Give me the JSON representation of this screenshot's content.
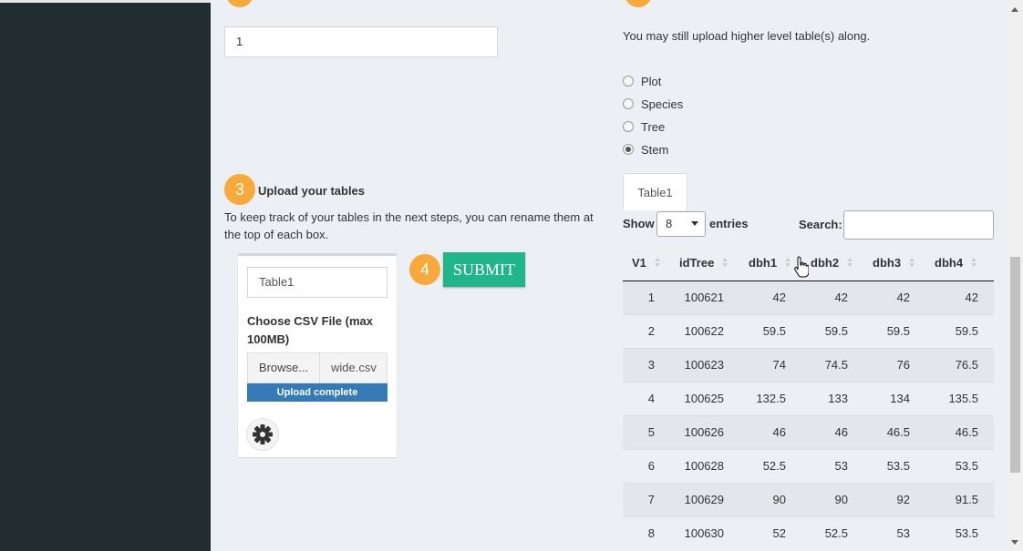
{
  "row_input": {
    "value": "1"
  },
  "step3": {
    "number": "3",
    "title": "Upload your tables",
    "description": "To keep track of your tables in the next steps, you can rename them at the top of each box."
  },
  "upload_box": {
    "table_name": "Table1",
    "csv_label": "Choose CSV File (max 100MB)",
    "browse_label": "Browse...",
    "filename": "wide.csv",
    "progress_label": "Upload complete",
    "progress_fraction": 1.0
  },
  "step4": {
    "number": "4",
    "submit_label": "SUBMIT"
  },
  "level_note": "You may still upload higher level table(s) along.",
  "levels": [
    {
      "label": "Plot",
      "checked": false
    },
    {
      "label": "Species",
      "checked": false
    },
    {
      "label": "Tree",
      "checked": false
    },
    {
      "label": "Stem",
      "checked": true
    }
  ],
  "table_tab": "Table1",
  "datatable": {
    "show_label": "Show",
    "page_length": "8",
    "entries_label": "entries",
    "search_label": "Search:",
    "columns": [
      "V1",
      "idTree",
      "dbh1",
      "dbh2",
      "dbh3",
      "dbh4"
    ],
    "rows": [
      [
        "1",
        "100621",
        "42",
        "42",
        "42",
        "42"
      ],
      [
        "2",
        "100622",
        "59.5",
        "59.5",
        "59.5",
        "59.5"
      ],
      [
        "3",
        "100623",
        "74",
        "74.5",
        "76",
        "76.5"
      ],
      [
        "4",
        "100625",
        "132.5",
        "133",
        "134",
        "135.5"
      ],
      [
        "5",
        "100626",
        "46",
        "46",
        "46.5",
        "46.5"
      ],
      [
        "6",
        "100628",
        "52.5",
        "53",
        "53.5",
        "53.5"
      ],
      [
        "7",
        "100629",
        "90",
        "90",
        "92",
        "91.5"
      ],
      [
        "8",
        "100630",
        "52",
        "52.5",
        "53",
        "53.5"
      ]
    ]
  },
  "colors": {
    "accent_orange": "#f7a93a",
    "submit_green": "#21b58a",
    "progress_blue": "#337ab7",
    "sidebar": "#222d32"
  }
}
